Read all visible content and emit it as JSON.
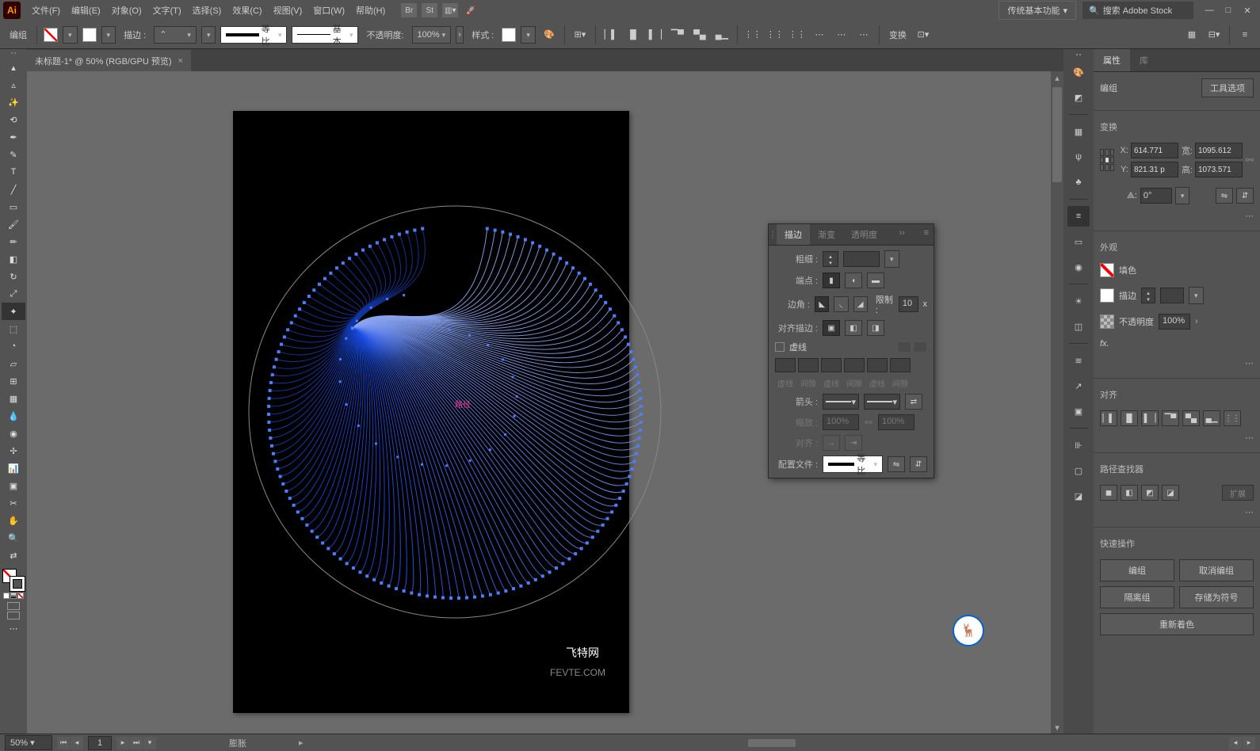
{
  "app": {
    "logo": "Ai"
  },
  "menu": {
    "file": "文件(F)",
    "edit": "编辑(E)",
    "object": "对象(O)",
    "type": "文字(T)",
    "select": "选择(S)",
    "effect": "效果(C)",
    "view": "视图(V)",
    "window": "窗口(W)",
    "help": "帮助(H)",
    "workspace": "传统基本功能",
    "searchPlaceholder": "搜索 Adobe Stock"
  },
  "control": {
    "selLabel": "编组",
    "strokeLabel": "描边 :",
    "profile1": "等比",
    "profile2": "基本",
    "opacityLabel": "不透明度:",
    "opacityValue": "100%",
    "styleLabel": "样式 :",
    "transformLabel": "变换"
  },
  "doc": {
    "tabTitle": "未标题-1* @ 50% (RGB/GPU 预览)",
    "pathLabel": "路径",
    "site": "飞特网",
    "siteEn": "FEVTE.COM"
  },
  "strokePanel": {
    "tabs": {
      "stroke": "描边",
      "gradient": "渐变",
      "transparency": "透明度"
    },
    "weight": "粗细 :",
    "cap": "端点 :",
    "corner": "边角 :",
    "limitLabel": "限制 :",
    "limitValue": "10",
    "limitX": "x",
    "align": "对齐描边 :",
    "dashed": "虚线",
    "dashLabels": [
      "虚线",
      "间隙",
      "虚线",
      "间隙",
      "虚线",
      "间隙"
    ],
    "arrow": "箭头 :",
    "scale": "缩放 :",
    "scaleVal": "100%",
    "alignArrow": "对齐 :",
    "profile": "配置文件 :",
    "profileVal": "等比"
  },
  "props": {
    "tabs": {
      "properties": "属性",
      "library": "库"
    },
    "selType": "编组",
    "toolOptions": "工具选项",
    "transform": "变换",
    "x": "614.771",
    "y": "821.31 p",
    "w": "1095.612",
    "h": "1073.571",
    "xLab": "X:",
    "yLab": "Y:",
    "wLab": "宽:",
    "hLab": "高:",
    "angle": "0°",
    "angleLab": "⟁:",
    "appearance": "外观",
    "fill": "填色",
    "stroke": "描边",
    "opacity": "不透明度",
    "opacityVal": "100%",
    "fx": "fx.",
    "alignTitle": "对齐",
    "pathfinderTitle": "路径查找器",
    "expand": "扩展",
    "quick": "快速操作",
    "group": "编组",
    "ungroup": "取消编组",
    "isolate": "隔离组",
    "saveSymbol": "存储为符号",
    "recolor": "重新着色"
  },
  "status": {
    "zoom": "50%",
    "artboard": "1",
    "tool": "膨胀"
  }
}
